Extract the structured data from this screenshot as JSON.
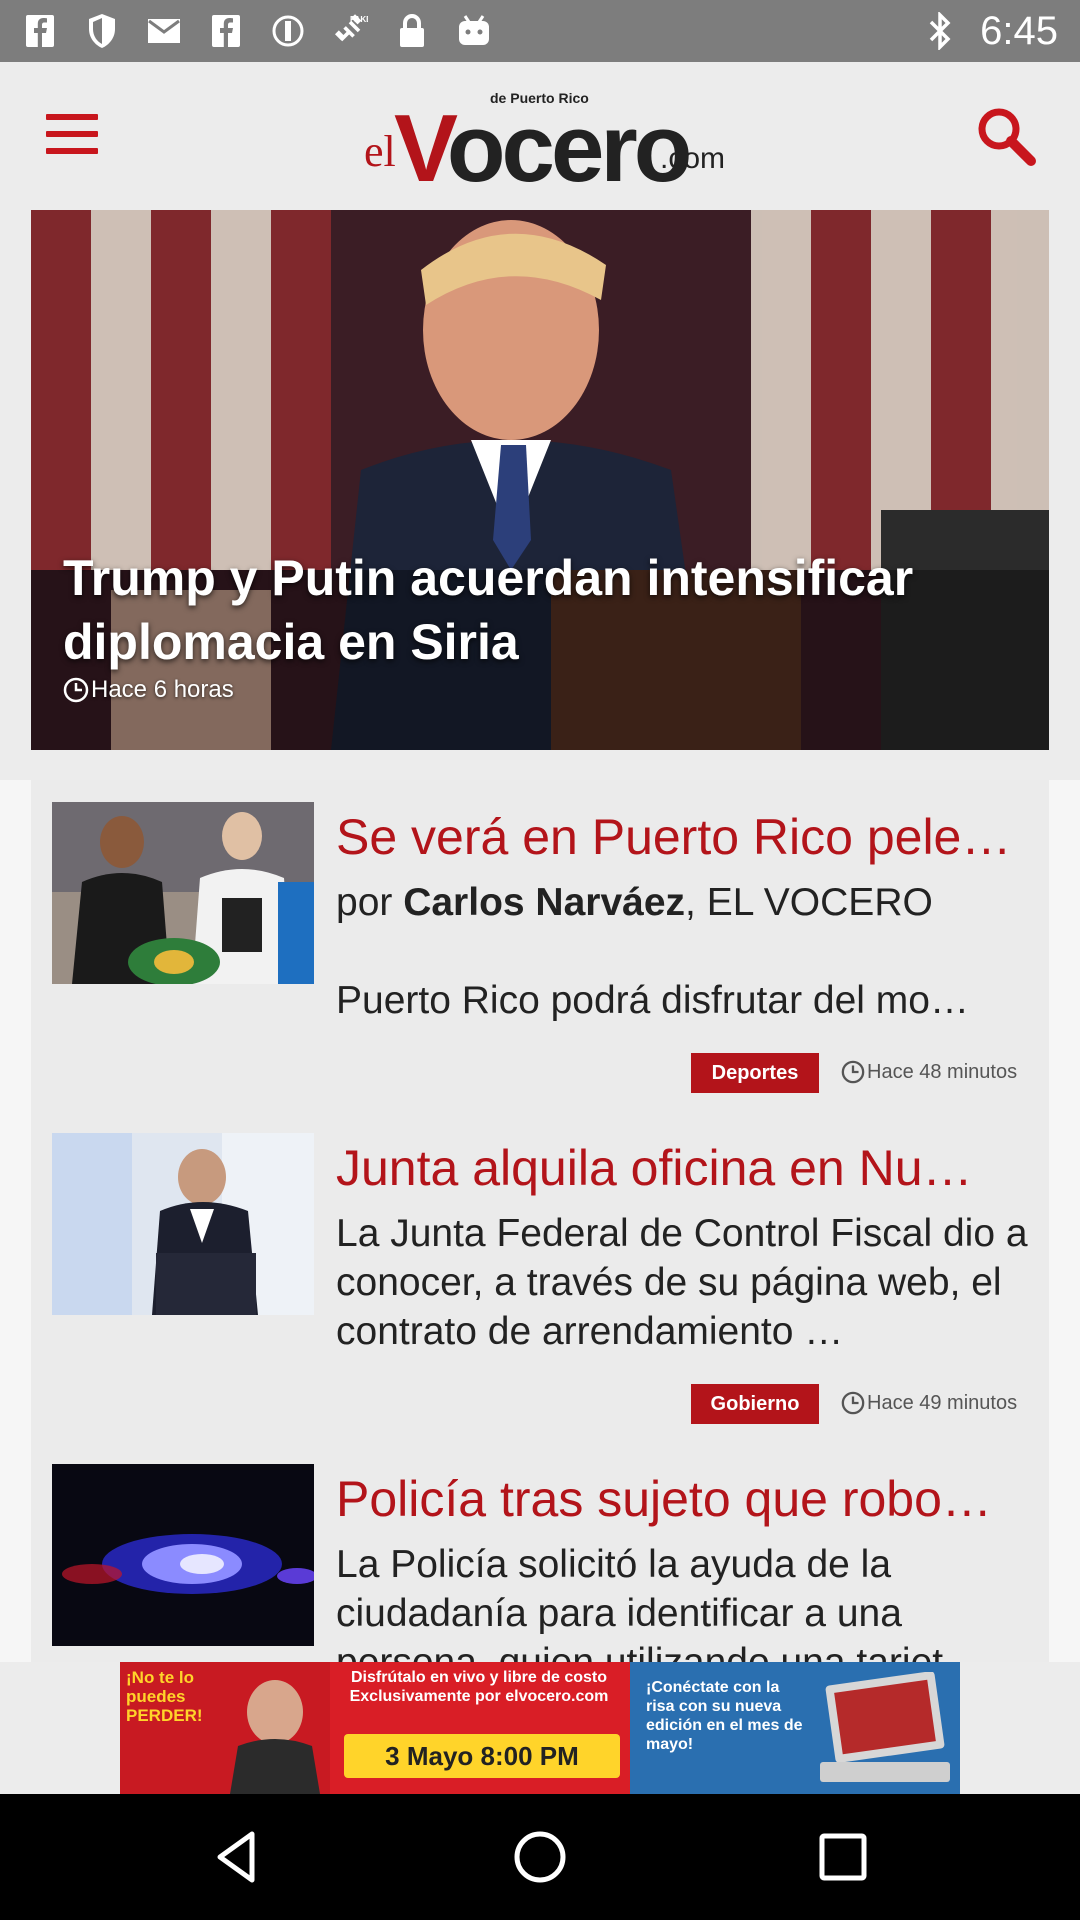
{
  "status_bar": {
    "time": "6:45",
    "icons": [
      "facebook-icon",
      "shield-icon",
      "mail-icon",
      "facebook-icon",
      "block-icon",
      "satellite-fake-gps-icon",
      "lock-icon",
      "android-icon",
      "bluetooth-icon"
    ]
  },
  "header": {
    "logo_prefix": "el",
    "logo_v": "V",
    "logo_rest": "ocero",
    "logo_tagline": "de Puerto Rico",
    "logo_suffix": ".com",
    "menu_icon": "hamburger-menu-icon",
    "search_icon": "search-icon"
  },
  "hero": {
    "title": "Trump y Putin acuerdan intensificar diplomacia en Siria",
    "time": "Hace 6 horas"
  },
  "articles": [
    {
      "title": "Se verá en Puerto Rico pele…",
      "byline_prefix": "por ",
      "byline_author": "Carlos Narváez",
      "byline_suffix": ", EL VOCERO",
      "excerpt": "Puerto Rico podrá disfrutar del mo…",
      "category": "Deportes",
      "time": "Hace 48 minutos"
    },
    {
      "title": "Junta alquila oficina en Nu…",
      "excerpt": "La Junta Federal de Control Fiscal dio a conocer, a través de su página web, el contrato de arrendamiento …",
      "category": "Gobierno",
      "time": "Hace 49 minutos"
    },
    {
      "title": "Policía tras sujeto que robo…",
      "excerpt": "La Policía solicitó la ayuda de la ciudadanía para identificar a una persona, quien utilizando una tarjet…"
    }
  ],
  "banner_ad": {
    "left_text": "¡No te lo puedes PERDER!",
    "middle_text": "Disfrútalo en vivo y libre de costo Exclusivamente por elvocero.com",
    "date_text": "3 Mayo  8:00 PM",
    "right_text": "¡Conéctate con la risa con su nueva edición en el mes de mayo!"
  },
  "colors": {
    "brand_red": "#b3141a",
    "status_bar": "#7d7d7d",
    "background": "#ececec"
  }
}
